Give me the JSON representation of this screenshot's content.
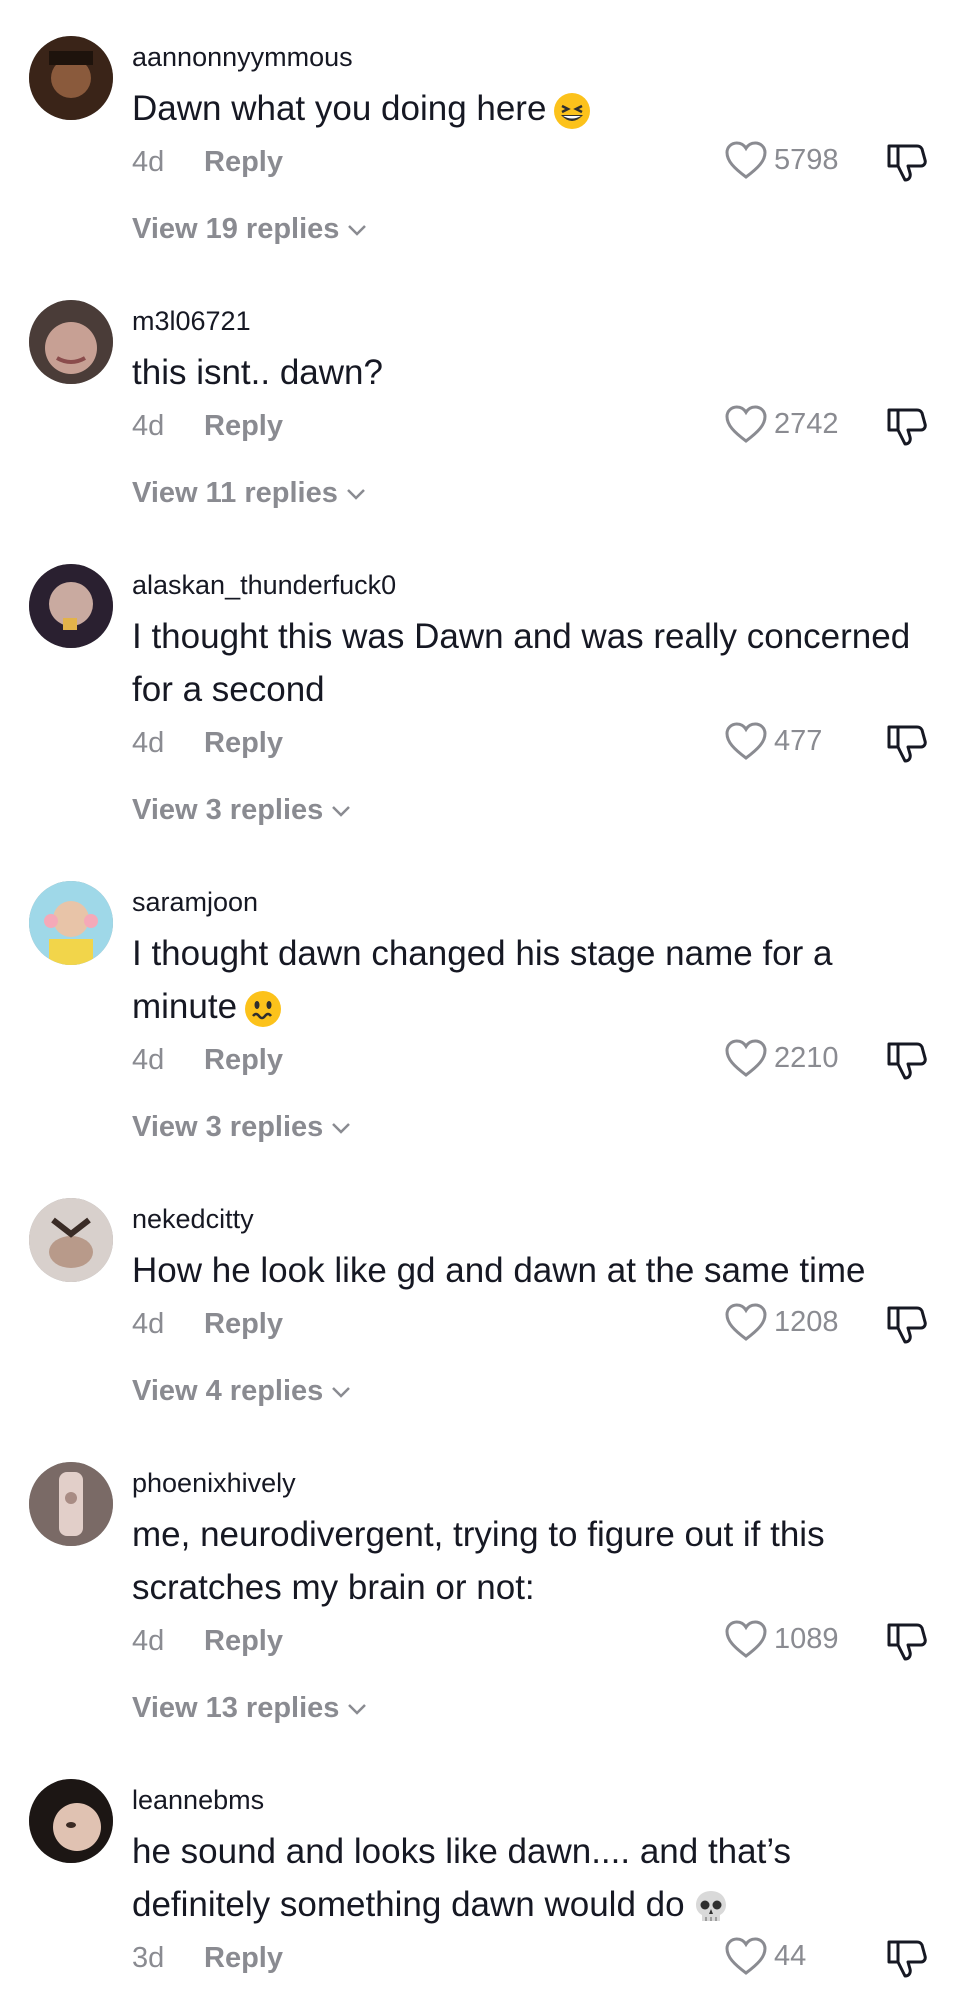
{
  "comments": [
    {
      "username": "aannonnyymmous",
      "text": "Dawn what you doing here",
      "emoji": "grinning-squint-emoji",
      "age": "4d",
      "reply_label": "Reply",
      "likes": "5798",
      "view_replies": "View 19 replies"
    },
    {
      "username": "m3l06721",
      "text": "this isnt.. dawn?",
      "age": "4d",
      "reply_label": "Reply",
      "likes": "2742",
      "view_replies": "View 11 replies"
    },
    {
      "username": "alaskan_thunderfuck0",
      "text": "I thought this was Dawn and was really concerned for a second",
      "age": "4d",
      "reply_label": "Reply",
      "likes": "477",
      "view_replies": "View 3 replies"
    },
    {
      "username": "saramjoon",
      "text": "I thought dawn changed his stage name for a minute",
      "emoji": "wavy-mouth-emoji",
      "age": "4d",
      "reply_label": "Reply",
      "likes": "2210",
      "view_replies": "View 3 replies"
    },
    {
      "username": "nekedcitty",
      "text": "How he look like gd and dawn at the same time",
      "age": "4d",
      "reply_label": "Reply",
      "likes": "1208",
      "view_replies": "View 4 replies"
    },
    {
      "username": "phoenixhively",
      "text": "me, neurodivergent, trying to figure out if this scratches my brain or not:",
      "age": "4d",
      "reply_label": "Reply",
      "likes": "1089",
      "view_replies": "View 13 replies"
    },
    {
      "username": "leannebms",
      "text": "he sound and looks like dawn.... and that’s definitely something dawn would do",
      "emoji": "skull-emoji",
      "age": "3d",
      "reply_label": "Reply",
      "likes": "44"
    }
  ],
  "colors": {
    "text": "#161823",
    "muted": "#8a8b91",
    "background": "#ffffff"
  },
  "icons": {
    "like": "heart-outline-icon",
    "dislike": "thumbs-down-icon",
    "expand": "chevron-down-icon"
  }
}
